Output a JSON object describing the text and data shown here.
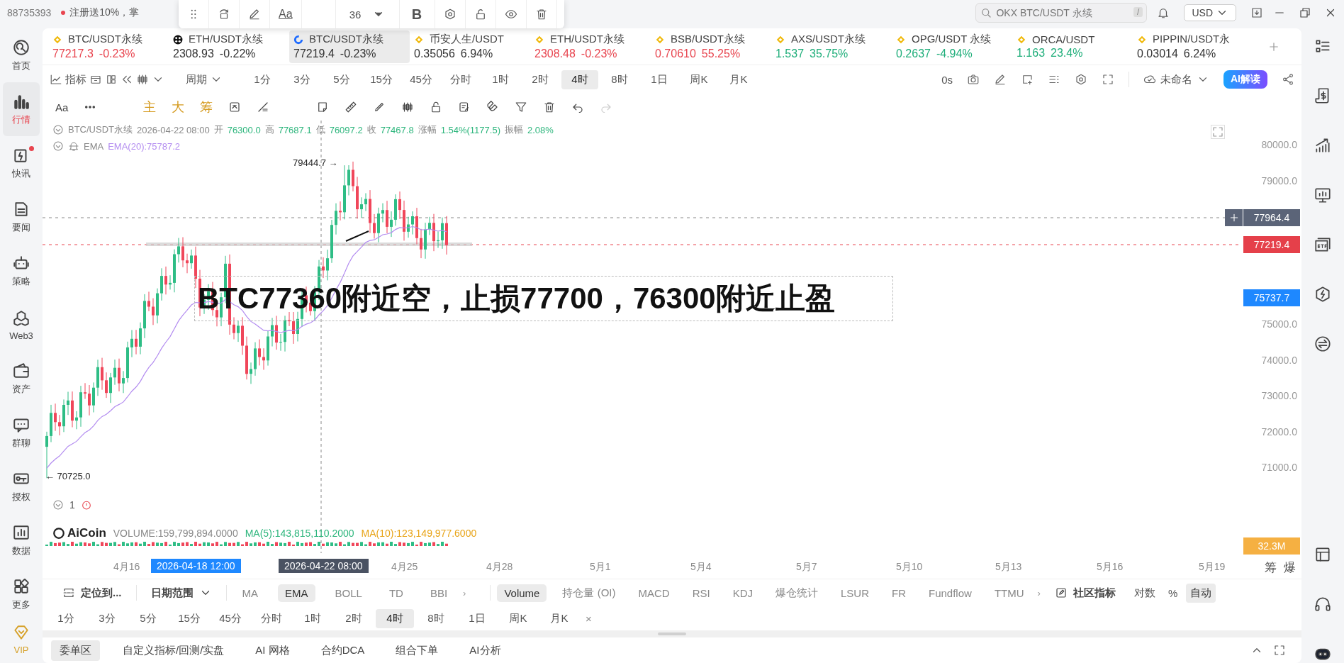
{
  "top_bar": {
    "account": "88735393",
    "promo": "注册送10%，掌",
    "search": {
      "placeholder": "OKX BTC/USDT 永续",
      "shortcut": "/"
    },
    "currency": "USD"
  },
  "text_toolbar": {
    "font_label": "Aa",
    "font_size": "36",
    "bold_label": "B"
  },
  "sidebar": {
    "items": [
      {
        "label": "首页",
        "kind": "home",
        "selected": false,
        "unread": false
      },
      {
        "label": "行情",
        "kind": "market",
        "selected": true,
        "unread": false
      },
      {
        "label": "快讯",
        "kind": "flash",
        "selected": false,
        "unread": true
      },
      {
        "label": "要闻",
        "kind": "news",
        "selected": false,
        "unread": false
      },
      {
        "label": "策略",
        "kind": "robot",
        "selected": false,
        "unread": false
      },
      {
        "label": "Web3",
        "kind": "web3",
        "selected": false,
        "unread": false
      },
      {
        "label": "资产",
        "kind": "wallet",
        "selected": false,
        "unread": false
      },
      {
        "label": "群聊",
        "kind": "chat",
        "selected": false,
        "unread": false
      },
      {
        "label": "授权",
        "kind": "key",
        "selected": false,
        "unread": false
      },
      {
        "label": "数据",
        "kind": "data",
        "selected": false,
        "unread": false
      },
      {
        "label": "更多",
        "kind": "more",
        "selected": false,
        "unread": false
      },
      {
        "label": "VIP",
        "kind": "vip",
        "selected": false,
        "unread": false
      }
    ]
  },
  "tickers": [
    {
      "kind": "diamond",
      "name": "BTC/USDT永续",
      "price": "77217.3",
      "change": "-0.23%",
      "color": "#e8454f",
      "selected": false
    },
    {
      "kind": "dots",
      "name": "ETH/USDT永续",
      "price": "2308.93",
      "change": "-0.22%",
      "color": "#333333",
      "selected": false
    },
    {
      "kind": "ring",
      "name": "BTC/USDT永续",
      "price": "77219.4",
      "change": "-0.23%",
      "color": "#333333",
      "selected": true
    },
    {
      "kind": "diamond",
      "name": "币安人生/USDT",
      "price": "0.35056",
      "change": "6.94%",
      "color": "#333333",
      "selected": false
    },
    {
      "kind": "diamond",
      "name": "ETH/USDT永续",
      "price": "2308.48",
      "change": "-0.23%",
      "color": "#e8454f",
      "selected": false
    },
    {
      "kind": "diamond",
      "name": "BSB/USDT永续",
      "price": "0.70610",
      "change": "55.25%",
      "color": "#e8454f",
      "selected": false
    },
    {
      "kind": "diamond",
      "name": "AXS/USDT永续",
      "price": "1.537",
      "change": "35.75%",
      "color": "#1fae7a",
      "selected": false
    },
    {
      "kind": "diamond",
      "name": "OPG/USDT 永续",
      "price": "0.2637",
      "change": "-4.94%",
      "color": "#1fae7a",
      "selected": false
    },
    {
      "kind": "diamond",
      "name": "ORCA/USDT",
      "price": "1.163",
      "change": "23.4%",
      "color": "#1fae7a",
      "selected": false
    },
    {
      "kind": "diamond",
      "name": "PIPPIN/USDT永",
      "price": "0.03014",
      "change": "6.24%",
      "color": "#333333",
      "selected": false
    }
  ],
  "chart_toolbar": {
    "indicator_label": "指标",
    "period_label": "周期",
    "periods": [
      {
        "label": "1分",
        "selected": false
      },
      {
        "label": "3分",
        "selected": false
      },
      {
        "label": "5分",
        "selected": false
      },
      {
        "label": "15分",
        "selected": false
      },
      {
        "label": "45分",
        "selected": false
      },
      {
        "label": "分时",
        "selected": false
      },
      {
        "label": "1时",
        "selected": false
      },
      {
        "label": "2时",
        "selected": false
      },
      {
        "label": "4时",
        "selected": true
      },
      {
        "label": "8时",
        "selected": false
      },
      {
        "label": "1日",
        "selected": false
      },
      {
        "label": "周K",
        "selected": false
      },
      {
        "label": "月K",
        "selected": false
      }
    ],
    "countdown": "0s",
    "layout_name": "未命名",
    "ai_button": "AI解读"
  },
  "drawing_toolbar": {
    "font_label": "Aa",
    "quick_tools": [
      "主",
      "大",
      "筹"
    ]
  },
  "legend": {
    "symbol": "BTC/USDT永续",
    "time": "2026-04-22 08:00",
    "fields": [
      {
        "label": "开",
        "value": "76300.0"
      },
      {
        "label": "高",
        "value": "77687.1"
      },
      {
        "label": "低",
        "value": "76097.2"
      },
      {
        "label": "收",
        "value": "77467.8"
      },
      {
        "label": "涨幅",
        "value": "1.54%(1177.5)"
      },
      {
        "label": "振幅",
        "value": "2.08%"
      }
    ],
    "ema": {
      "name": "EMA",
      "value": "EMA(20):75787.2"
    }
  },
  "chart": {
    "max_label": "79444.7 →",
    "min_label": "← 70725.0",
    "annotation": "BTC77360附近空，止损77700，76300附近止盈",
    "price_axis": [
      "80000.0",
      "79000.0",
      "75000.0",
      "74000.0",
      "73000.0",
      "72000.0",
      "71000.0"
    ],
    "price_tags": [
      {
        "kind": "crosshair",
        "value": "77964.4"
      },
      {
        "kind": "last",
        "value": "77219.4"
      },
      {
        "kind": "ema",
        "value": "75737.7"
      },
      {
        "kind": "volume",
        "value": "32.3M"
      }
    ],
    "pane_count": "1",
    "volume": {
      "brand": "AiCoin",
      "label": "VOLUME:159,799,894.0000",
      "ma5": "MA(5):143,815,110.2000",
      "ma10": "MA(10):123,149,977.6000"
    },
    "date_axis": [
      {
        "label": "4月16",
        "kind": "tick"
      },
      {
        "label": "2026-04-18 12:00",
        "kind": "cursor-blue"
      },
      {
        "label": "2026-04-22 08:00",
        "kind": "cursor-dark"
      },
      {
        "label": "4月25",
        "kind": "tick"
      },
      {
        "label": "4月28",
        "kind": "tick"
      },
      {
        "label": "5月1",
        "kind": "tick"
      },
      {
        "label": "5月4",
        "kind": "tick"
      },
      {
        "label": "5月7",
        "kind": "tick"
      },
      {
        "label": "5月10",
        "kind": "tick"
      },
      {
        "label": "5月13",
        "kind": "tick"
      },
      {
        "label": "5月16",
        "kind": "tick"
      },
      {
        "label": "5月19",
        "kind": "tick"
      }
    ],
    "side_labels": [
      "筹",
      "爆"
    ]
  },
  "indicator_bar": {
    "locate": "定位到...",
    "date_range": "日期范围",
    "main_indicators": [
      {
        "label": "MA",
        "selected": false
      },
      {
        "label": "EMA",
        "selected": true
      },
      {
        "label": "BOLL",
        "selected": false
      },
      {
        "label": "TD",
        "selected": false
      },
      {
        "label": "BBI",
        "selected": false
      }
    ],
    "main_more": "›",
    "sub_indicators": [
      {
        "label": "Volume",
        "selected": true
      },
      {
        "label": "持仓量 (OI)",
        "selected": false
      },
      {
        "label": "MACD",
        "selected": false
      },
      {
        "label": "RSI",
        "selected": false
      },
      {
        "label": "KDJ",
        "selected": false
      },
      {
        "label": "爆仓统计",
        "selected": false
      },
      {
        "label": "LSUR",
        "selected": false
      },
      {
        "label": "FR",
        "selected": false
      },
      {
        "label": "Fundflow",
        "selected": false
      },
      {
        "label": "TTMU",
        "selected": false
      }
    ],
    "sub_more": "›",
    "community": "社区指标",
    "scales": [
      {
        "label": "对数",
        "selected": false
      },
      {
        "label": "%",
        "selected": false
      },
      {
        "label": "自动",
        "selected": true
      }
    ]
  },
  "period_row": {
    "periods": [
      {
        "label": "1分",
        "selected": false
      },
      {
        "label": "3分",
        "selected": false
      },
      {
        "label": "5分",
        "selected": false
      },
      {
        "label": "15分",
        "selected": false
      },
      {
        "label": "45分",
        "selected": false
      },
      {
        "label": "分时",
        "selected": false
      },
      {
        "label": "1时",
        "selected": false
      },
      {
        "label": "2时",
        "selected": false
      },
      {
        "label": "4时",
        "selected": true
      },
      {
        "label": "8时",
        "selected": false
      },
      {
        "label": "1日",
        "selected": false
      },
      {
        "label": "周K",
        "selected": false
      },
      {
        "label": "月K",
        "selected": false
      }
    ],
    "close": "×"
  },
  "bottom_tabs": [
    {
      "label": "委单区",
      "selected": true
    },
    {
      "label": "自定义指标/回测/实盘",
      "selected": false
    },
    {
      "label": "AI 网格",
      "selected": false
    },
    {
      "label": "合约DCA",
      "selected": false
    },
    {
      "label": "组合下单",
      "selected": false
    },
    {
      "label": "AI分析",
      "selected": false
    }
  ]
}
